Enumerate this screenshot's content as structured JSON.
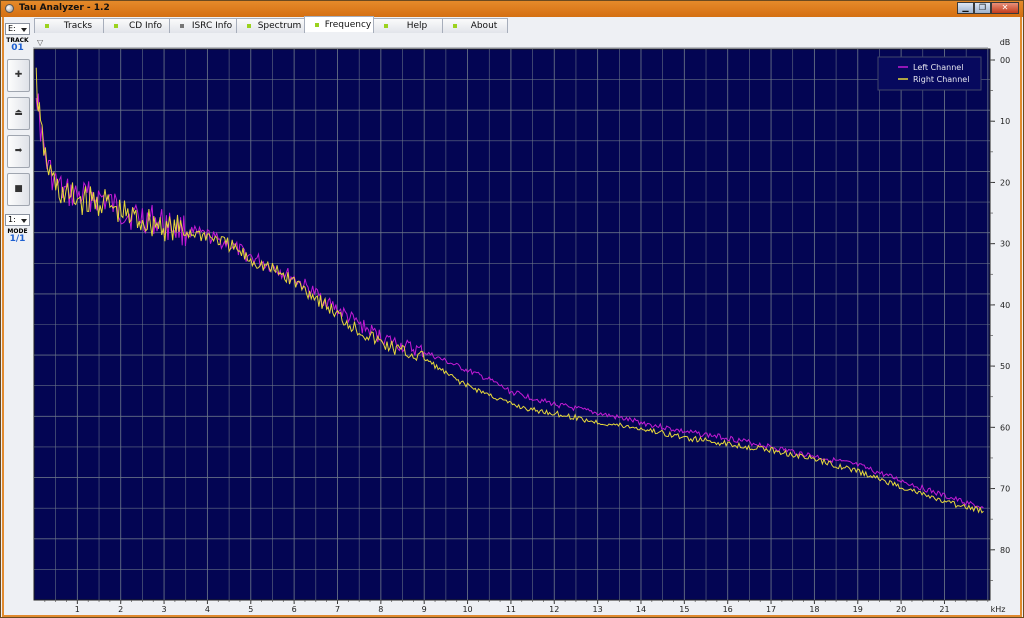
{
  "window": {
    "title": "Tau Analyzer - 1.2"
  },
  "tabs": [
    {
      "label": "Tracks",
      "led": "green"
    },
    {
      "label": "CD Info",
      "led": "green"
    },
    {
      "label": "ISRC Info",
      "led": "grey"
    },
    {
      "label": "Spectrum",
      "led": "green"
    },
    {
      "label": "Frequency",
      "led": "green",
      "active": true
    },
    {
      "label": "Help",
      "led": "green"
    },
    {
      "label": "About",
      "led": "green"
    }
  ],
  "left_panel": {
    "drive_select": "E:",
    "track_caption": "TRACK",
    "track_number": "01",
    "buttons": [
      {
        "icon": "plus-icon",
        "glyph": "✚"
      },
      {
        "icon": "eject-icon",
        "glyph": "⏏"
      },
      {
        "icon": "play-icon",
        "glyph": "➡"
      },
      {
        "icon": "stop-icon",
        "glyph": "■"
      }
    ],
    "mode_select": "1:",
    "mode_caption": "MODE",
    "mode_value": "1/1"
  },
  "chart_data": {
    "type": "line",
    "background": "#030553",
    "grid_color": "#6f7a8a",
    "xlabel": "kHz",
    "ylabel": "dB",
    "xlim": [
      0,
      22.05
    ],
    "ylim": [
      0,
      90
    ],
    "y_inverted": true,
    "x_ticks": [
      "1",
      "2",
      "3",
      "4",
      "5",
      "6",
      "7",
      "8",
      "9",
      "10",
      "11",
      "12",
      "13",
      "14",
      "15",
      "16",
      "17",
      "18",
      "19",
      "20",
      "21"
    ],
    "y_ticks": [
      "00",
      "10",
      "20",
      "30",
      "40",
      "50",
      "60",
      "70",
      "80"
    ],
    "grid": true,
    "legend_position": "top-right",
    "x": [
      0.05,
      0.15,
      0.3,
      0.5,
      0.7,
      1,
      1.3,
      1.6,
      1.9,
      2.2,
      2.5,
      2.8,
      3.2,
      3.6,
      4,
      4.5,
      5,
      5.5,
      6,
      6.5,
      7,
      7.5,
      8,
      8.5,
      9,
      9.5,
      10,
      10.5,
      11,
      11.5,
      12,
      13,
      14,
      15,
      16,
      17,
      18,
      19,
      20,
      21,
      21.9
    ],
    "series": [
      {
        "name": "Left Channel",
        "color": "#c21bd3",
        "values": [
          6,
          13,
          19,
          22,
          23.5,
          24,
          24,
          24.5,
          26,
          27,
          27.5,
          28,
          29,
          30,
          30.5,
          32,
          34,
          35.5,
          37.5,
          40,
          42.5,
          45,
          47,
          48.5,
          49.5,
          51,
          52.5,
          54,
          56,
          57,
          58,
          59.5,
          61,
          62.5,
          63.5,
          65,
          66.5,
          68,
          70.5,
          73,
          75
        ]
      },
      {
        "name": "Right Channel",
        "color": "#e6d83a",
        "values": [
          5,
          13,
          19,
          22.5,
          24,
          24.5,
          25,
          25,
          26.5,
          27.5,
          28,
          28.5,
          29.5,
          30,
          30.5,
          32,
          34.5,
          36,
          38,
          40.5,
          43.5,
          46,
          48,
          49.5,
          50.5,
          53,
          55,
          56.5,
          58,
          59,
          59.5,
          61,
          62,
          63.5,
          64.5,
          65.5,
          67,
          69,
          71.5,
          74,
          75.5
        ]
      }
    ]
  }
}
